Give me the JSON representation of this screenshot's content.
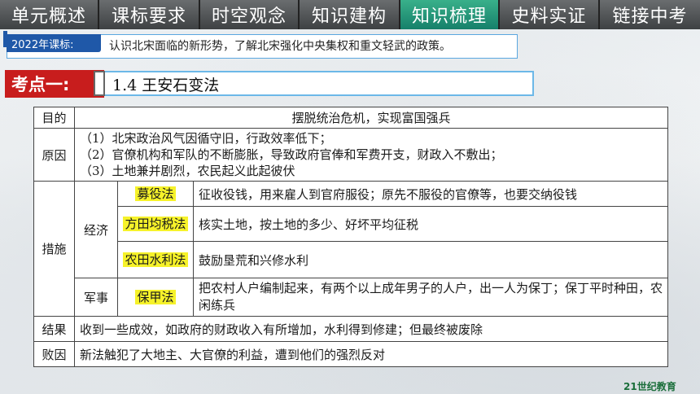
{
  "nav": {
    "items": [
      "单元概述",
      "课标要求",
      "时空观念",
      "知识建构",
      "知识梳理",
      "史料实证",
      "链接中考"
    ],
    "active_index": 4
  },
  "standard": {
    "label": "2022年课标:",
    "text": "认识北宋面临的新形势，了解北宋强化中央集权和重文轻武的政策。"
  },
  "exam_point": {
    "label": "考点一:",
    "title": "1.4 王安石变法"
  },
  "table": {
    "purpose": {
      "head": "目的",
      "text": "摆脱统治危机，实现富国强兵"
    },
    "reason": {
      "head": "原因",
      "lines": [
        "（1）北宋政治风气因循守旧，行政效率低下；",
        "（2）官僚机构和军队的不断膨胀，导致政府官俸和军费开支，财政入不敷出；",
        "（3）土地兼并剧烈，农民起义此起彼伏"
      ]
    },
    "measures": {
      "head": "措施",
      "economy": {
        "head": "经济",
        "items": [
          {
            "name": "募役法",
            "desc": "征收役钱，用来雇人到官府服役；原先不服役的官僚等，也要交纳役钱"
          },
          {
            "name": "方田均税法",
            "desc": "核实土地，按土地的多少、好坏平均征税"
          },
          {
            "name": "农田水利法",
            "desc": "鼓励垦荒和兴修水利"
          }
        ]
      },
      "military": {
        "head": "军事",
        "items": [
          {
            "name": "保甲法",
            "desc": "把农村人户编制起来，有两个以上成年男子的人户，出一人为保丁；保丁平时种田，农闲练兵"
          }
        ]
      }
    },
    "result": {
      "head": "结果",
      "text": "收到一些成效，如政府的财政收入有所增加，水利得到修建；但最终被废除"
    },
    "failure": {
      "head": "败因",
      "text": "新法触犯了大地主、大官僚的利益，遭到他们的强烈反对"
    }
  },
  "logo": {
    "text": "21世纪教育"
  }
}
